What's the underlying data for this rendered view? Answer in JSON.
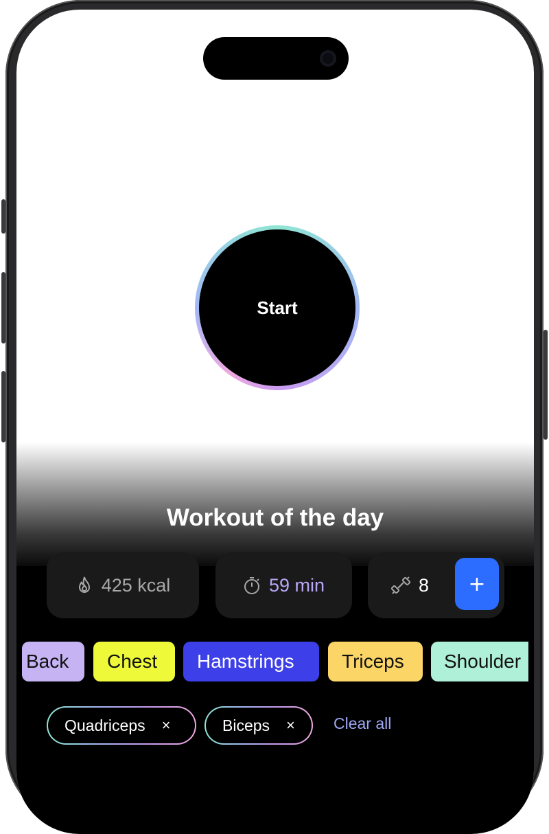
{
  "start_button": {
    "label": "Start"
  },
  "workout": {
    "title": "Workout of the day"
  },
  "stats": {
    "calories": "425 kcal",
    "duration": "59 min",
    "exercises": "8",
    "add_label": "+"
  },
  "muscle_groups": [
    {
      "label": "Back",
      "color": "#c6b3f4"
    },
    {
      "label": "Chest",
      "color": "#eef93a"
    },
    {
      "label": "Hamstrings",
      "color": "#3d3fe8"
    },
    {
      "label": "Triceps",
      "color": "#fcd567"
    },
    {
      "label": "Shoulder",
      "color": "#aef0d8"
    }
  ],
  "selected_filters": [
    {
      "label": "Quadriceps",
      "remove": "×"
    },
    {
      "label": "Biceps",
      "remove": "×"
    }
  ],
  "clear_all": "Clear all",
  "icons": {
    "calories": "flame-icon",
    "duration": "stopwatch-icon",
    "exercises": "dumbbell-icon"
  }
}
